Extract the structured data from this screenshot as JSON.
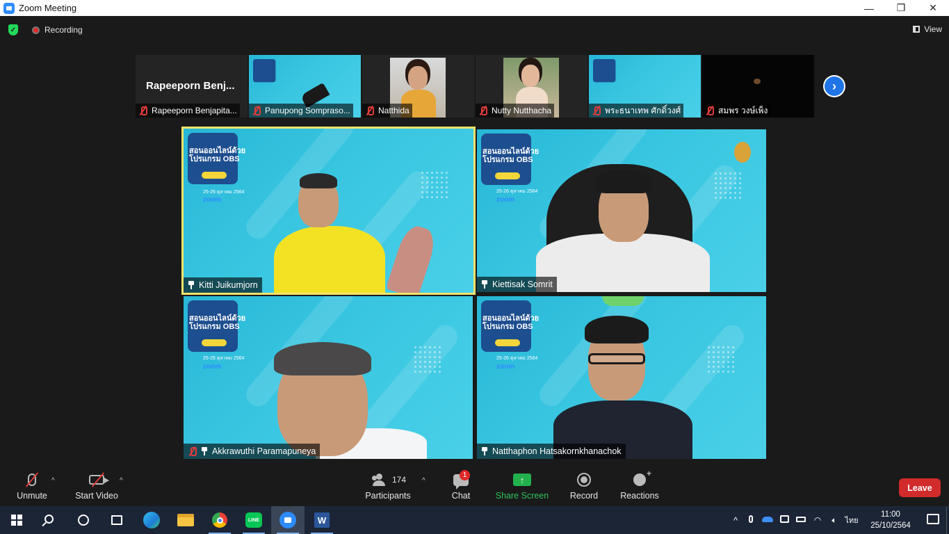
{
  "window": {
    "title": "Zoom Meeting",
    "controls": [
      "—",
      "❐",
      "✕"
    ]
  },
  "topbar": {
    "recording_label": "Recording",
    "view_label": "View"
  },
  "thumbnails": [
    {
      "name": "Rapeeporn Benjapita...",
      "big_label": "Rapeeporn  Benj...",
      "muted": true
    },
    {
      "name": "Panupong Somprasо...",
      "muted": true
    },
    {
      "name": "Natthida",
      "muted": true
    },
    {
      "name": "Nutty Nutthacha",
      "muted": true
    },
    {
      "name": "พระธนาเทพ ศักดิ์วงศ์",
      "muted": true
    },
    {
      "name": "สมพร วงษ์เพ็ง",
      "muted": true
    }
  ],
  "gallery": [
    {
      "name": "Kitti Juikumjorn",
      "active_speaker": true
    },
    {
      "name": "Kiettisak Somrit"
    },
    {
      "name": "Akkrawuthi Paramapuneya"
    },
    {
      "name": "Natthaphon Hatsakornkhanachok"
    }
  ],
  "poster": {
    "title_line1": "สอนออนไลน์ด้วย",
    "title_line2": "โปรแกรม OBS",
    "date": "25-26 ตุลาคม 2564",
    "zoom": "zoom"
  },
  "toolbar": {
    "unmute": "Unmute",
    "start_video": "Start Video",
    "participants": "Participants",
    "participants_count": "174",
    "chat": "Chat",
    "chat_badge": "1",
    "share_screen": "Share Screen",
    "record": "Record",
    "reactions": "Reactions",
    "leave": "Leave"
  },
  "taskbar": {
    "time": "11:00",
    "date": "25/10/2564",
    "lang": "ไทย"
  }
}
